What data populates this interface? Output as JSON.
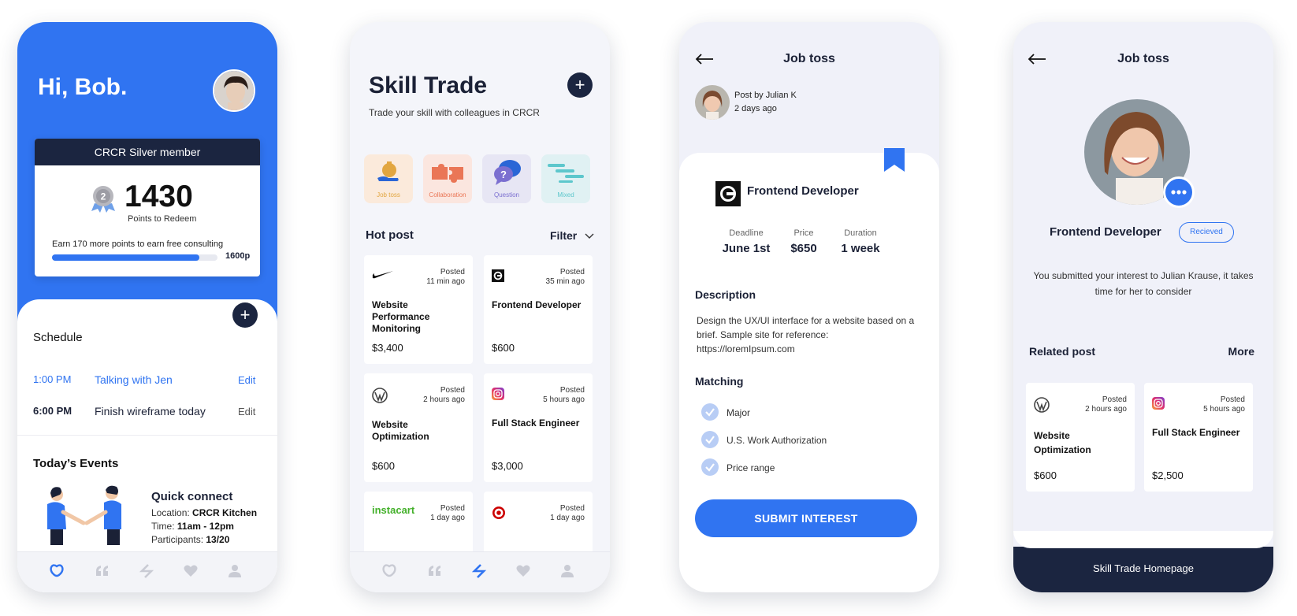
{
  "screen1": {
    "greeting": "Hi, Bob.",
    "membership": "CRCR Silver member",
    "points": "1430",
    "points_label": "Points to Redeem",
    "earn_text": "Earn 170 more points to earn free consulting",
    "progress_fraction": 0.89,
    "progress_target": "1600p",
    "schedule_title": "Schedule",
    "schedule": [
      {
        "time": "1:00 PM",
        "task": "Talking with Jen",
        "edit": "Edit",
        "highlight": true
      },
      {
        "time": "6:00 PM",
        "task": "Finish wireframe today",
        "edit": "Edit",
        "highlight": false
      }
    ],
    "events_title": "Today’s Events",
    "event": {
      "title": "Quick connect",
      "location_label": "Location:",
      "location": "CRCR Kitchen",
      "time_label": "Time:",
      "time": "11am - 12pm",
      "participants_label": "Participants:",
      "participants": "13/20"
    }
  },
  "screen2": {
    "title": "Skill Trade",
    "subtitle": "Trade your skill with colleagues in CRCR",
    "categories": [
      {
        "label": "Job toss",
        "bg": "#fbeadb",
        "color": "#e2a640"
      },
      {
        "label": "Collaboration",
        "bg": "#fbe6df",
        "color": "#ea7656"
      },
      {
        "label": "Question",
        "bg": "#e7e6f4",
        "color": "#7b6fd0"
      },
      {
        "label": "Mixed",
        "bg": "#e0f1f3",
        "color": "#5dc7cc"
      }
    ],
    "hot_post": "Hot post",
    "filter": "Filter",
    "posts": [
      {
        "logo": "nike-logo",
        "posted": "Posted",
        "ago": "11 min ago",
        "title": "Website Performance Monitoring",
        "price": "$3,400"
      },
      {
        "logo": "uber-logo",
        "posted": "Posted",
        "ago": "35 min ago",
        "title": "Frontend Developer",
        "price": "$600"
      },
      {
        "logo": "wordpress-logo",
        "posted": "Posted",
        "ago": "2 hours ago",
        "title": "Website Optimization",
        "price": "$600"
      },
      {
        "logo": "instagram-logo",
        "posted": "Posted",
        "ago": "5 hours ago",
        "title": "Full Stack Engineer",
        "price": "$3,000"
      },
      {
        "logo": "instacart-logo",
        "logo_text": "instacart",
        "posted": "Posted",
        "ago": "1 day ago"
      },
      {
        "logo": "target-logo",
        "posted": "Posted",
        "ago": "1 day ago"
      }
    ]
  },
  "screen3": {
    "title": "Job toss",
    "post_by": "Post by Julian K",
    "post_ago": "2 days ago",
    "job_title": "Frontend Developer",
    "meta": [
      {
        "label": "Deadline",
        "value": "June 1st"
      },
      {
        "label": "Price",
        "value": "$650"
      },
      {
        "label": "Duration",
        "value": "1 week"
      }
    ],
    "description_title": "Description",
    "description": "Design the UX/UI interface for a website based on a brief. Sample site for reference: https://loremIpsum.com",
    "matching_title": "Matching",
    "matching": [
      "Major",
      "U.S. Work Authorization",
      "Price range"
    ],
    "submit": "SUBMIT INTEREST"
  },
  "screen4": {
    "title": "Job toss",
    "job_title": "Frontend Developer",
    "status": "Recieved",
    "message": "You submitted your interest to Julian Krause, it takes time for her to consider",
    "related_title": "Related post",
    "more": "More",
    "related": [
      {
        "logo": "wordpress-logo",
        "posted": "Posted",
        "ago": "2 hours ago",
        "title": "Website Optimization",
        "price": "$600"
      },
      {
        "logo": "instagram-logo",
        "posted": "Posted",
        "ago": "5 hours ago",
        "title": "Full Stack Engineer",
        "price": "$2,500"
      }
    ],
    "home": "Skill Trade Homepage"
  },
  "colors": {
    "primary": "#3074f1",
    "navy": "#1b2540",
    "background": "#f0f1f9"
  }
}
